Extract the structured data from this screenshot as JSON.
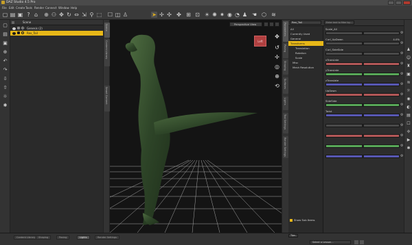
{
  "window": {
    "title": "DAZ Studio 4.5 Pro"
  },
  "menu": [
    "File",
    "Edit",
    "Create",
    "Tools",
    "Render",
    "Connect",
    "Window",
    "Help"
  ],
  "toolbar_icons": [
    "file-new-icon",
    "file-open-icon",
    "save-icon",
    "help-icon",
    "mode1-icon",
    "mode2-icon",
    "mode3-icon",
    "mode4-icon",
    "mode5-icon",
    "mode6-icon",
    "mode7-icon",
    "mode8-icon",
    "mode9-icon",
    "mode10-icon",
    "mode11-icon",
    "mode12-icon",
    "mode13-icon",
    "mode14-icon",
    "mode15-icon",
    "mode16-icon"
  ],
  "scene": {
    "header": "Scene",
    "rows": [
      {
        "label": "Genesis (2)",
        "selected": false
      },
      {
        "label": "Rex_Tail",
        "selected": true
      }
    ]
  },
  "scene_tabs": [
    "Scene",
    "Content Library",
    "Smart Content"
  ],
  "viewport": {
    "view_label": "Perspective View",
    "cube_label": "Left"
  },
  "param_tabs": [
    "Parameters",
    "Posing",
    "Shaping",
    "Surfaces",
    "Lights",
    "Tool Settings",
    "Render Settings"
  ],
  "params": {
    "node_select": "Rex_Tail",
    "search_placeholder": "Enter text to filter by...",
    "tree": [
      {
        "label": "All",
        "selected": false
      },
      {
        "label": "Currently Used",
        "selected": false
      },
      {
        "label": "General",
        "selected": false
      },
      {
        "label": "Transforms",
        "selected": true
      },
      {
        "label": "Translation",
        "selected": false
      },
      {
        "label": "Rotation",
        "selected": false
      },
      {
        "label": "Scale",
        "selected": false
      },
      {
        "label": "Misc",
        "selected": false
      },
      {
        "label": "Mesh Resolution",
        "selected": false
      }
    ],
    "show_sub_items": "Show Sub Items",
    "items": [
      {
        "label": "Scale_All",
        "value": "",
        "color": "gray"
      },
      {
        "label": "Curl_UpDown",
        "value": "4.0%",
        "color": "gray"
      },
      {
        "label": "Curl_SideSide",
        "value": "",
        "color": "gray"
      },
      {
        "label": "xTranslate",
        "value": "",
        "color": "red"
      },
      {
        "label": "yTranslate",
        "value": "",
        "color": "green"
      },
      {
        "label": "zTranslate",
        "value": "",
        "color": "blue"
      },
      {
        "label": "UpDown",
        "value": "",
        "color": "red"
      },
      {
        "label": "SideSide",
        "value": "",
        "color": "green"
      },
      {
        "label": "Twist",
        "value": "",
        "color": "blue"
      },
      {
        "label": "",
        "value": "",
        "color": "gray"
      },
      {
        "label": "",
        "value": "",
        "color": "red"
      },
      {
        "label": "",
        "value": "",
        "color": "green"
      },
      {
        "label": "",
        "value": "",
        "color": "blue"
      }
    ]
  },
  "bottom": {
    "tabs": [
      "Content Library",
      "Shaping",
      "Posing",
      "Lights",
      "Render Settings"
    ],
    "active_tab": "Lights",
    "lesson_label": "Select a Lesson...",
    "tips_label": "Tips"
  },
  "colors": {
    "accent": "#e8b818",
    "viewport_bg": "#141414",
    "figure": "#3c5a34"
  }
}
